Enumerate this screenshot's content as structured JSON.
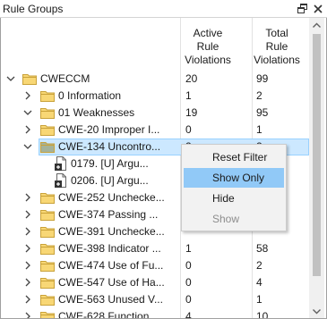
{
  "window": {
    "title": "Rule Groups",
    "restore_icon": "restore-window-icon",
    "close_icon": "close-icon"
  },
  "columns": {
    "active": "Active\nRule\nViolations",
    "total": "Total\nRule\nViolations"
  },
  "colors": {
    "selection_fill": "#cce8ff",
    "selection_border": "#99d1ff",
    "menu_highlight": "#91c9f7",
    "folder_fill": "#f8d775",
    "folder_selected_fill": "#a5b39a"
  },
  "tree": {
    "rows": [
      {
        "label": "CWECCM",
        "active": "20",
        "total": "99",
        "expanded": true
      },
      {
        "label": "0 Information",
        "active": "1",
        "total": "2",
        "expanded": false
      },
      {
        "label": "01 Weaknesses",
        "active": "19",
        "total": "95",
        "expanded": true
      },
      {
        "label": "CWE-20 Improper I...",
        "active": "0",
        "total": "1",
        "expanded": false
      },
      {
        "label": "CWE-134 Uncontro...",
        "active": "2",
        "total": "2",
        "expanded": true,
        "selected": true
      },
      {
        "label": "0179.  [U] Argu...",
        "active": "",
        "total": "",
        "leaf": true
      },
      {
        "label": "0206.  [U] Argu...",
        "active": "",
        "total": "",
        "leaf": true
      },
      {
        "label": "CWE-252 Unchecke...",
        "active": "",
        "total": "",
        "expanded": false
      },
      {
        "label": "CWE-374 Passing ...",
        "active": "",
        "total": "",
        "expanded": false
      },
      {
        "label": "CWE-391 Unchecke...",
        "active": "",
        "total": "",
        "expanded": false
      },
      {
        "label": "CWE-398 Indicator ...",
        "active": "1",
        "total": "58",
        "expanded": false
      },
      {
        "label": "CWE-474 Use of Fu...",
        "active": "0",
        "total": "2",
        "expanded": false
      },
      {
        "label": "CWE-547 Use of Ha...",
        "active": "0",
        "total": "4",
        "expanded": false
      },
      {
        "label": "CWE-563 Unused V...",
        "active": "0",
        "total": "1",
        "expanded": false
      },
      {
        "label": "CWE-628 Function ...",
        "active": "4",
        "total": "10",
        "expanded": false
      }
    ]
  },
  "context_menu": {
    "items": [
      {
        "label": "Reset Filter",
        "state": "normal"
      },
      {
        "label": "Show Only",
        "state": "highlighted"
      },
      {
        "label": "Hide",
        "state": "normal"
      },
      {
        "label": "Show",
        "state": "disabled"
      }
    ]
  }
}
